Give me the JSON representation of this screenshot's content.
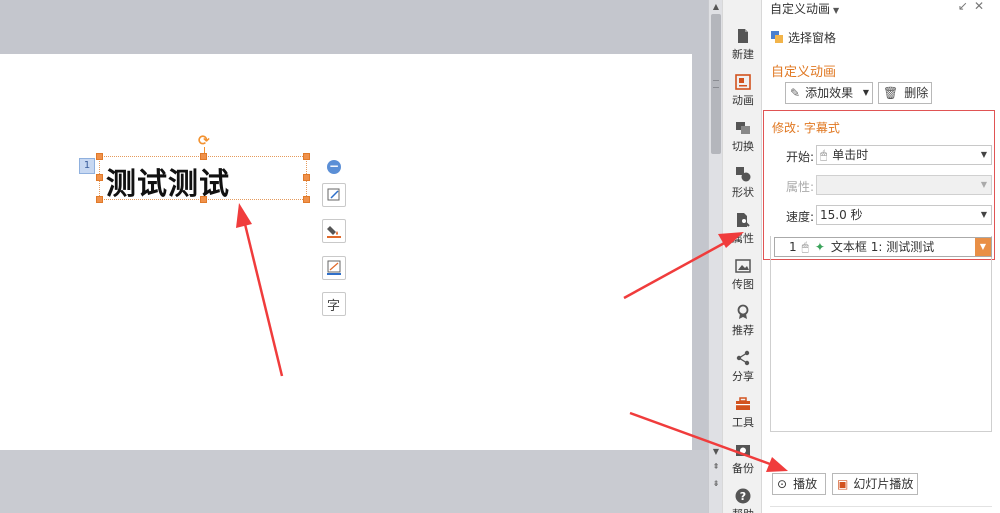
{
  "slide": {
    "textbox_text": "测试测试",
    "animation_badge": "1"
  },
  "side_strip": {
    "items": [
      {
        "label": "新建",
        "icon": "new-doc-icon"
      },
      {
        "label": "动画",
        "icon": "animation-icon"
      },
      {
        "label": "切换",
        "icon": "transition-icon"
      },
      {
        "label": "形状",
        "icon": "shape-icon"
      },
      {
        "label": "属性",
        "icon": "properties-icon"
      },
      {
        "label": "传图",
        "icon": "upload-image-icon"
      },
      {
        "label": "推荐",
        "icon": "recommend-icon"
      },
      {
        "label": "分享",
        "icon": "share-icon"
      },
      {
        "label": "工具",
        "icon": "toolbox-icon"
      },
      {
        "label": "备份",
        "icon": "backup-icon"
      },
      {
        "label": "帮助",
        "icon": "help-icon"
      }
    ]
  },
  "mini_toolbar": {
    "text_tool_label": "字"
  },
  "pane": {
    "title": "自定义动画",
    "selection_pane_label": "选择窗格",
    "section_title": "自定义动画",
    "add_effect_label": "添加效果",
    "delete_label": "删除",
    "modify_title": "修改: 字幕式",
    "start_label": "开始:",
    "start_value": "单击时",
    "property_label": "属性:",
    "property_value": "",
    "speed_label": "速度:",
    "speed_value": "15.0 秒",
    "effect_index": "1",
    "effect_text": "文本框 1: 测试测试",
    "play_label": "播放",
    "slideshow_label": "幻灯片播放"
  },
  "colors": {
    "accent_orange": "#e07822",
    "highlight_red": "#e05454",
    "annotation_arrow": "#f03c3c"
  }
}
